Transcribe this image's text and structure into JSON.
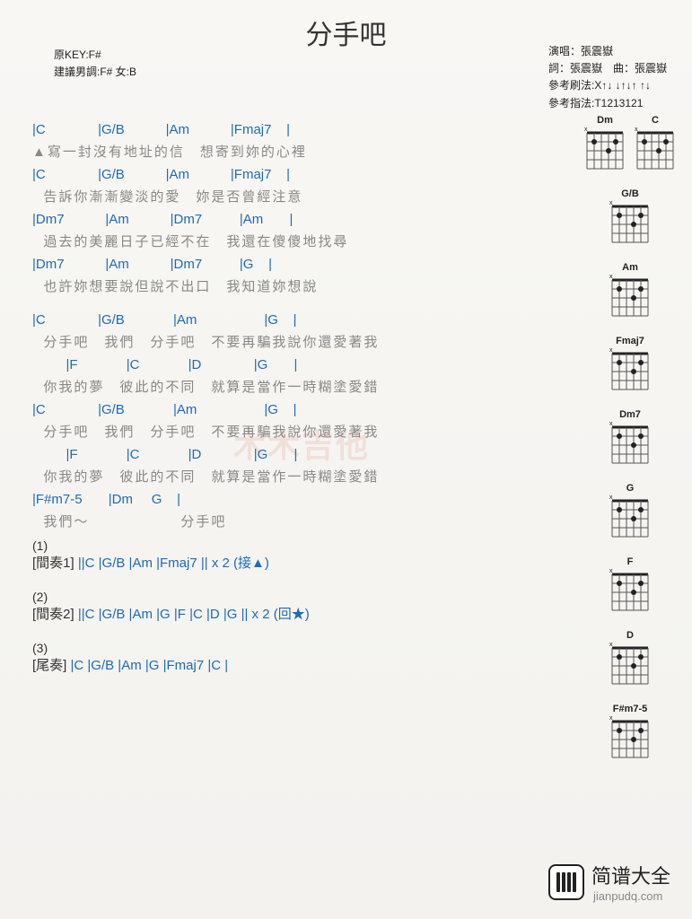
{
  "title": "分手吧",
  "meta_left": {
    "key": "原KEY:F#",
    "suggest": "建議男調:F# 女:B"
  },
  "meta_right": {
    "singer": "演唱：張震嶽",
    "credit": "詞：張震嶽　曲：張震嶽",
    "strum": "參考刷法:X↑↓ ↓↑↓↑ ↑↓",
    "pick": "參考指法:T1213121"
  },
  "verses": [
    {
      "chords": "|C              |G/B           |Am           |Fmaj7    |",
      "lyrics": "▲寫一封沒有地址的信　想寄到妳的心裡"
    },
    {
      "chords": "|C              |G/B           |Am           |Fmaj7    |",
      "lyrics": "  告訴你漸漸變淡的愛　妳是否曾經注意"
    },
    {
      "chords": "|Dm7           |Am           |Dm7          |Am       |",
      "lyrics": "  過去的美麗日子已經不在　我還在傻傻地找尋"
    },
    {
      "chords": "|Dm7           |Am           |Dm7          |G    |",
      "lyrics": "  也許妳想要說但說不出口　我知道妳想說"
    }
  ],
  "chorus": [
    {
      "chords": "|C              |G/B             |Am                  |G    |",
      "lyrics": "  分手吧　我們　分手吧　不要再騙我說你還愛著我"
    },
    {
      "chords": "         |F             |C             |D              |G       |",
      "lyrics": "  你我的夢　彼此的不同　就算是當作一時糊塗愛錯"
    },
    {
      "chords": "|C              |G/B             |Am                  |G    |",
      "lyrics": "  分手吧　我們　分手吧　不要再騙我說你還愛著我"
    },
    {
      "chords": "         |F             |C             |D              |G       |",
      "lyrics": "  你我的夢　彼此的不同　就算是當作一時糊塗愛錯"
    },
    {
      "chords": "|F#m7-5       |Dm     G    |",
      "lyrics": "  我們～　　　　　　分手吧"
    }
  ],
  "interludes": [
    {
      "num": "(1)",
      "label": "[間奏1]",
      "seq": " ||C   |G/B   |Am   |Fmaj7   || x 2  (接▲)"
    },
    {
      "num": "(2)",
      "label": "[間奏2]",
      "seq": " ||C   |G/B   |Am   |G   |F   |C    |D   |G   || x 2 (回★)"
    },
    {
      "num": "(3)",
      "label": "[尾奏]",
      "seq": " |C   |G/B   |Am    |G    |Fmaj7    |C    |"
    }
  ],
  "diagram_labels": [
    "Dm",
    "C",
    "G/B",
    "Am",
    "Fmaj7",
    "Dm7",
    "G",
    "F",
    "D",
    "F#m7-5"
  ],
  "watermark": "木木吉他",
  "logo_text": "简谱大全",
  "logo_sub": "jianpudq.com"
}
